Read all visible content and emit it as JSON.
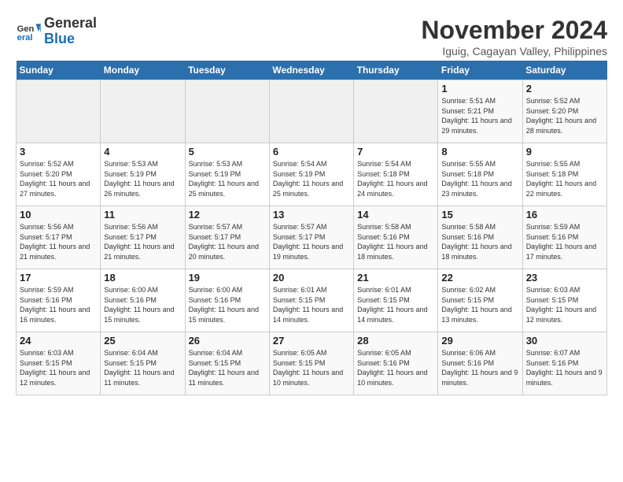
{
  "logo": {
    "line1": "General",
    "line2": "Blue"
  },
  "title": "November 2024",
  "subtitle": "Iguig, Cagayan Valley, Philippines",
  "days_header": [
    "Sunday",
    "Monday",
    "Tuesday",
    "Wednesday",
    "Thursday",
    "Friday",
    "Saturday"
  ],
  "weeks": [
    [
      {
        "day": "",
        "info": ""
      },
      {
        "day": "",
        "info": ""
      },
      {
        "day": "",
        "info": ""
      },
      {
        "day": "",
        "info": ""
      },
      {
        "day": "",
        "info": ""
      },
      {
        "day": "1",
        "info": "Sunrise: 5:51 AM\nSunset: 5:21 PM\nDaylight: 11 hours and 29 minutes."
      },
      {
        "day": "2",
        "info": "Sunrise: 5:52 AM\nSunset: 5:20 PM\nDaylight: 11 hours and 28 minutes."
      }
    ],
    [
      {
        "day": "3",
        "info": "Sunrise: 5:52 AM\nSunset: 5:20 PM\nDaylight: 11 hours and 27 minutes."
      },
      {
        "day": "4",
        "info": "Sunrise: 5:53 AM\nSunset: 5:19 PM\nDaylight: 11 hours and 26 minutes."
      },
      {
        "day": "5",
        "info": "Sunrise: 5:53 AM\nSunset: 5:19 PM\nDaylight: 11 hours and 25 minutes."
      },
      {
        "day": "6",
        "info": "Sunrise: 5:54 AM\nSunset: 5:19 PM\nDaylight: 11 hours and 25 minutes."
      },
      {
        "day": "7",
        "info": "Sunrise: 5:54 AM\nSunset: 5:18 PM\nDaylight: 11 hours and 24 minutes."
      },
      {
        "day": "8",
        "info": "Sunrise: 5:55 AM\nSunset: 5:18 PM\nDaylight: 11 hours and 23 minutes."
      },
      {
        "day": "9",
        "info": "Sunrise: 5:55 AM\nSunset: 5:18 PM\nDaylight: 11 hours and 22 minutes."
      }
    ],
    [
      {
        "day": "10",
        "info": "Sunrise: 5:56 AM\nSunset: 5:17 PM\nDaylight: 11 hours and 21 minutes."
      },
      {
        "day": "11",
        "info": "Sunrise: 5:56 AM\nSunset: 5:17 PM\nDaylight: 11 hours and 21 minutes."
      },
      {
        "day": "12",
        "info": "Sunrise: 5:57 AM\nSunset: 5:17 PM\nDaylight: 11 hours and 20 minutes."
      },
      {
        "day": "13",
        "info": "Sunrise: 5:57 AM\nSunset: 5:17 PM\nDaylight: 11 hours and 19 minutes."
      },
      {
        "day": "14",
        "info": "Sunrise: 5:58 AM\nSunset: 5:16 PM\nDaylight: 11 hours and 18 minutes."
      },
      {
        "day": "15",
        "info": "Sunrise: 5:58 AM\nSunset: 5:16 PM\nDaylight: 11 hours and 18 minutes."
      },
      {
        "day": "16",
        "info": "Sunrise: 5:59 AM\nSunset: 5:16 PM\nDaylight: 11 hours and 17 minutes."
      }
    ],
    [
      {
        "day": "17",
        "info": "Sunrise: 5:59 AM\nSunset: 5:16 PM\nDaylight: 11 hours and 16 minutes."
      },
      {
        "day": "18",
        "info": "Sunrise: 6:00 AM\nSunset: 5:16 PM\nDaylight: 11 hours and 15 minutes."
      },
      {
        "day": "19",
        "info": "Sunrise: 6:00 AM\nSunset: 5:16 PM\nDaylight: 11 hours and 15 minutes."
      },
      {
        "day": "20",
        "info": "Sunrise: 6:01 AM\nSunset: 5:15 PM\nDaylight: 11 hours and 14 minutes."
      },
      {
        "day": "21",
        "info": "Sunrise: 6:01 AM\nSunset: 5:15 PM\nDaylight: 11 hours and 14 minutes."
      },
      {
        "day": "22",
        "info": "Sunrise: 6:02 AM\nSunset: 5:15 PM\nDaylight: 11 hours and 13 minutes."
      },
      {
        "day": "23",
        "info": "Sunrise: 6:03 AM\nSunset: 5:15 PM\nDaylight: 11 hours and 12 minutes."
      }
    ],
    [
      {
        "day": "24",
        "info": "Sunrise: 6:03 AM\nSunset: 5:15 PM\nDaylight: 11 hours and 12 minutes."
      },
      {
        "day": "25",
        "info": "Sunrise: 6:04 AM\nSunset: 5:15 PM\nDaylight: 11 hours and 11 minutes."
      },
      {
        "day": "26",
        "info": "Sunrise: 6:04 AM\nSunset: 5:15 PM\nDaylight: 11 hours and 11 minutes."
      },
      {
        "day": "27",
        "info": "Sunrise: 6:05 AM\nSunset: 5:15 PM\nDaylight: 11 hours and 10 minutes."
      },
      {
        "day": "28",
        "info": "Sunrise: 6:05 AM\nSunset: 5:16 PM\nDaylight: 11 hours and 10 minutes."
      },
      {
        "day": "29",
        "info": "Sunrise: 6:06 AM\nSunset: 5:16 PM\nDaylight: 11 hours and 9 minutes."
      },
      {
        "day": "30",
        "info": "Sunrise: 6:07 AM\nSunset: 5:16 PM\nDaylight: 11 hours and 9 minutes."
      }
    ]
  ]
}
